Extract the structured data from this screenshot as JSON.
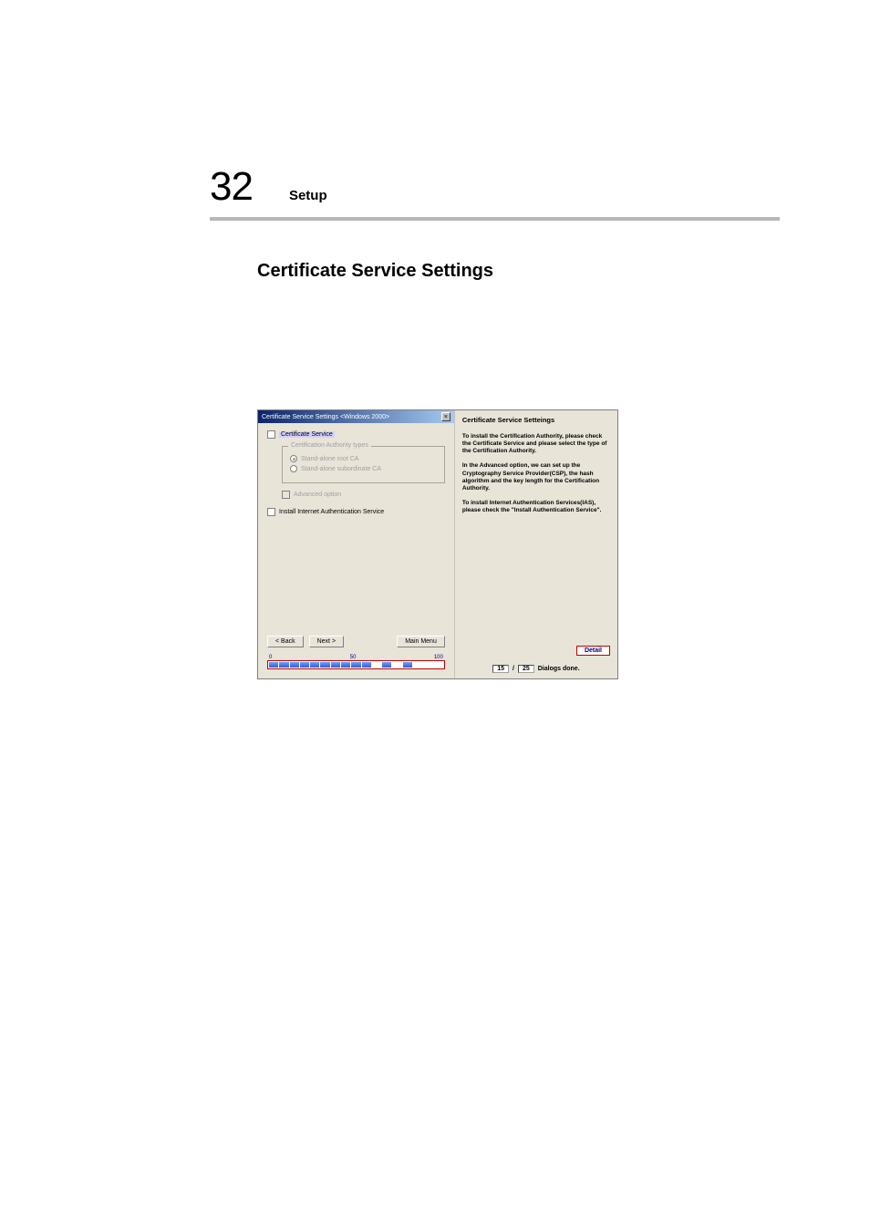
{
  "page": {
    "number": "32",
    "header_label": "Setup",
    "section_title": "Certificate Service Settings"
  },
  "dialog": {
    "titlebar": "Certificate Service Settings <Windows 2000>",
    "checkbox_certificate_service": "Certificate Service",
    "fieldset_legend": "Certification Authority types",
    "radio_root": "Stand-alone root CA",
    "radio_subordinate": "Stand-alone subordinate CA",
    "checkbox_advanced": "Advanced option",
    "checkbox_ias": "Install Internet Authentication Service",
    "btn_back": "< Back",
    "btn_next": "Next >",
    "btn_main_menu": "Main Menu",
    "progress": {
      "min": "0",
      "mid": "50",
      "max": "100"
    }
  },
  "right": {
    "title": "Certificate Service Setteings",
    "para1": "To install the Certification Authority, please check the Certificate Service and please select the type of the Certification Authority.",
    "para2": "In the Advanced option, we can set up the Cryptography Service Provider(CSP), the hash algorithm and the key length for the Certification Authority.",
    "para3": "To install Internet Authentication Services(IAS), please check the \"Install Authentication Service\".",
    "detail_btn": "Detail"
  },
  "footer": {
    "done": "15",
    "slash": "/",
    "total": "25",
    "label": "Dialogs done."
  }
}
